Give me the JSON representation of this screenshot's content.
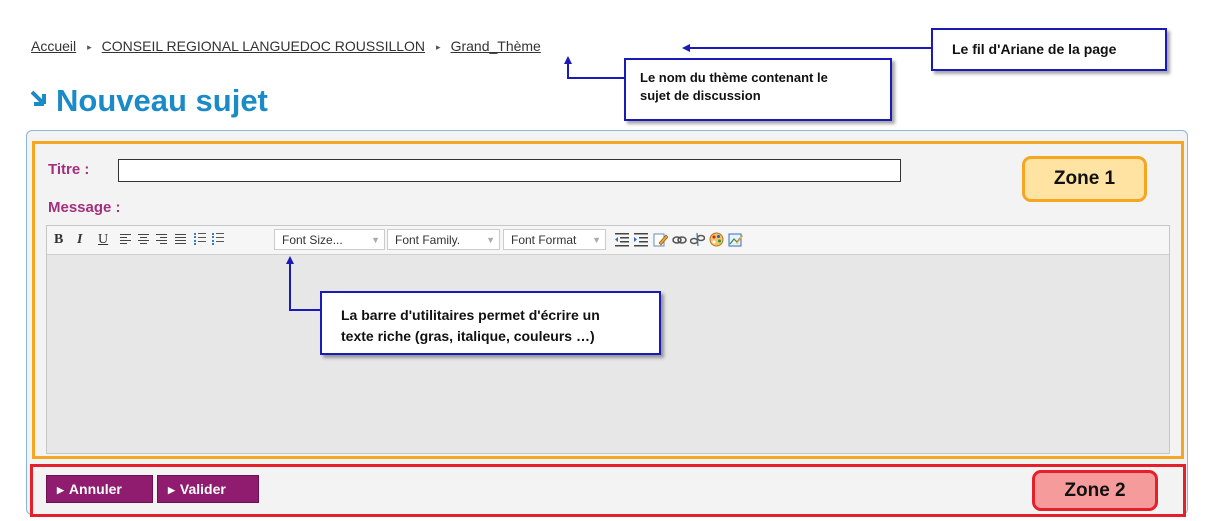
{
  "breadcrumb": {
    "items": [
      "Accueil",
      "CONSEIL REGIONAL LANGUEDOC ROUSSILLON",
      "Grand_Thème"
    ],
    "separator": "▸"
  },
  "page_title": "Nouveau sujet",
  "form": {
    "title_label": "Titre :",
    "title_value": "",
    "message_label": "Message :"
  },
  "toolbar": {
    "bold": "B",
    "italic": "I",
    "underline": "U",
    "font_size": "Font Size...",
    "font_family": "Font Family.",
    "font_format": "Font Format",
    "icons": [
      "align-left-icon",
      "align-center-icon",
      "align-right-icon",
      "align-justify-icon",
      "unordered-list-icon",
      "ordered-list-icon",
      "outdent-icon",
      "indent-icon",
      "edit-html-icon",
      "link-icon",
      "unlink-icon",
      "color-palette-icon",
      "insert-image-icon"
    ]
  },
  "buttons": {
    "cancel": "Annuler",
    "validate": "Valider"
  },
  "annotations": {
    "ariane": "Le fil d'Ariane de la page",
    "theme_line1": "Le nom du thème contenant le",
    "theme_line2": "sujet de discussion",
    "toolbar_line1": "La barre d'utilitaires permet d'écrire un",
    "toolbar_line2": "texte riche (gras, italique, couleurs …)",
    "zone1": "Zone 1",
    "zone2": "Zone 2"
  },
  "colors": {
    "title_blue": "#1b8bc8",
    "label_purple": "#a42f7f",
    "button_purple": "#8f1c6f",
    "zone1_orange": "#f5a623",
    "zone2_red": "#e6202a",
    "callout_blue": "#1a1ab8"
  }
}
